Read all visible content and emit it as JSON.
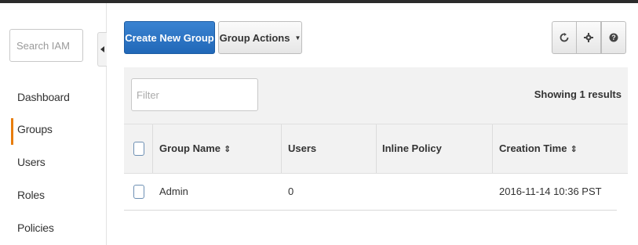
{
  "sidebar": {
    "search_placeholder": "Search IAM",
    "items": [
      {
        "label": "Dashboard"
      },
      {
        "label": "Groups"
      },
      {
        "label": "Users"
      },
      {
        "label": "Roles"
      },
      {
        "label": "Policies"
      }
    ],
    "active_item": "Groups",
    "active_color": "#e87d0d"
  },
  "toolbar": {
    "create_label": "Create New Group",
    "actions_label": "Group Actions",
    "primary_color": "#2b74c7",
    "icons": [
      "refresh-icon",
      "gear-icon",
      "help-icon"
    ]
  },
  "table": {
    "filter_placeholder": "Filter",
    "results_text": "Showing 1 results",
    "headers": [
      {
        "label": "Group Name",
        "sortable": true
      },
      {
        "label": "Users",
        "sortable": false
      },
      {
        "label": "Inline Policy",
        "sortable": false
      },
      {
        "label": "Creation Time",
        "sortable": true
      }
    ],
    "rows": [
      {
        "name": "Admin",
        "users": "0",
        "inline_policy": "",
        "created": "2016-11-14 10:36 PST"
      }
    ]
  }
}
